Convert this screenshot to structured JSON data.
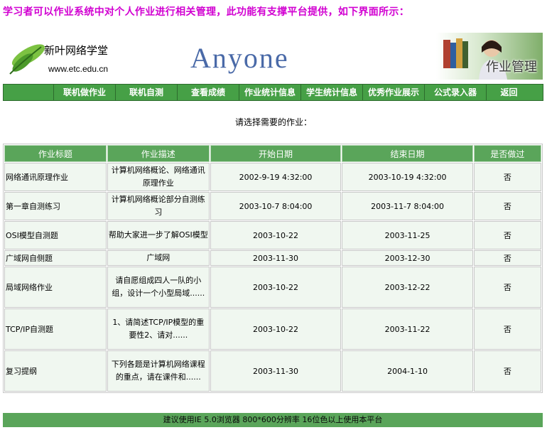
{
  "intro": "学习者可以作业系统中对个人作业进行相关管理，此功能有支撑平台提供，如下界面所示：",
  "banner": {
    "left_title": "新叶网络学堂",
    "left_url": "www.etc.edu.cn",
    "center_text": "Anyone",
    "right_text": "作业管理"
  },
  "nav": [
    "联机做作业",
    "联机自测",
    "查看成绩",
    "作业统计信息",
    "学生统计信息",
    "优秀作业展示",
    "公式录入器",
    "返回"
  ],
  "prompt": "请选择需要的作业：",
  "table": {
    "headers": [
      "作业标题",
      "作业描述",
      "开始日期",
      "结束日期",
      "是否做过"
    ],
    "rows": [
      {
        "title": "网络通讯原理作业",
        "desc": "计算机网络概论、网络通讯原理作业",
        "start": "2002-9-19 4:32:00",
        "end": "2003-10-19 4:32:00",
        "done": "否"
      },
      {
        "title": "第一章自测练习",
        "desc": "计算机网络概论部分自测练习",
        "start": "2003-10-7 8:04:00",
        "end": "2003-11-7 8:04:00",
        "done": "否"
      },
      {
        "title": "OSI模型自测题",
        "desc": "帮助大家进一步了解OSI模型",
        "start": "2003-10-22",
        "end": "2003-11-25",
        "done": "否"
      },
      {
        "title": "广域网自侧题",
        "desc": "广域网",
        "start": "2003-11-30",
        "end": "2003-12-30",
        "done": "否"
      },
      {
        "title": "局域网络作业",
        "desc": "请自愿组成四人一队的小组，设计一个小型局域......",
        "start": "2003-10-22",
        "end": "2003-12-22",
        "done": "否"
      },
      {
        "title": "TCP/IP自测题",
        "desc": "1、请简述TCP/IP模型的重要性2、请对......",
        "start": "2003-10-22",
        "end": "2003-11-22",
        "done": "否"
      },
      {
        "title": "复习提纲",
        "desc": "下列各题是计算机网络课程的重点，请在课件和......",
        "start": "2003-11-30",
        "end": "2004-1-10",
        "done": "否"
      }
    ]
  },
  "footer": "建议使用IE 5.0浏览器 800*600分辨率 16位色以上使用本平台"
}
